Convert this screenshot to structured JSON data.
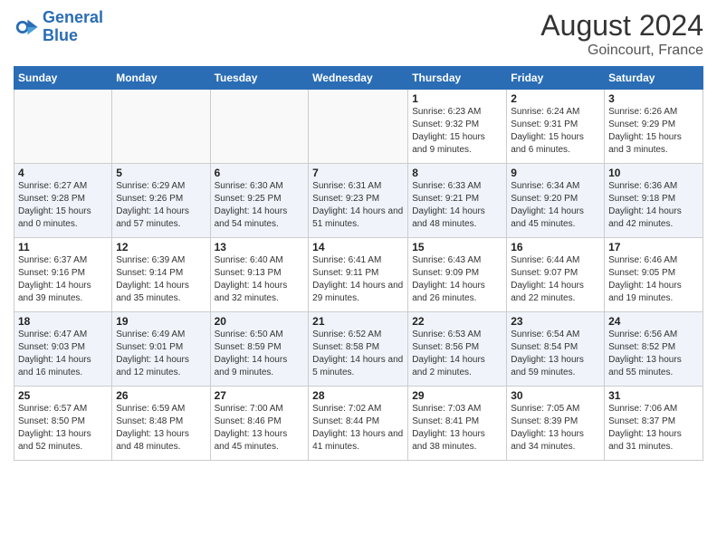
{
  "header": {
    "logo_line1": "General",
    "logo_line2": "Blue",
    "month": "August 2024",
    "location": "Goincourt, France"
  },
  "columns": [
    "Sunday",
    "Monday",
    "Tuesday",
    "Wednesday",
    "Thursday",
    "Friday",
    "Saturday"
  ],
  "weeks": [
    [
      {
        "num": "",
        "info": ""
      },
      {
        "num": "",
        "info": ""
      },
      {
        "num": "",
        "info": ""
      },
      {
        "num": "",
        "info": ""
      },
      {
        "num": "1",
        "info": "Sunrise: 6:23 AM\nSunset: 9:32 PM\nDaylight: 15 hours and 9 minutes."
      },
      {
        "num": "2",
        "info": "Sunrise: 6:24 AM\nSunset: 9:31 PM\nDaylight: 15 hours and 6 minutes."
      },
      {
        "num": "3",
        "info": "Sunrise: 6:26 AM\nSunset: 9:29 PM\nDaylight: 15 hours and 3 minutes."
      }
    ],
    [
      {
        "num": "4",
        "info": "Sunrise: 6:27 AM\nSunset: 9:28 PM\nDaylight: 15 hours and 0 minutes."
      },
      {
        "num": "5",
        "info": "Sunrise: 6:29 AM\nSunset: 9:26 PM\nDaylight: 14 hours and 57 minutes."
      },
      {
        "num": "6",
        "info": "Sunrise: 6:30 AM\nSunset: 9:25 PM\nDaylight: 14 hours and 54 minutes."
      },
      {
        "num": "7",
        "info": "Sunrise: 6:31 AM\nSunset: 9:23 PM\nDaylight: 14 hours and 51 minutes."
      },
      {
        "num": "8",
        "info": "Sunrise: 6:33 AM\nSunset: 9:21 PM\nDaylight: 14 hours and 48 minutes."
      },
      {
        "num": "9",
        "info": "Sunrise: 6:34 AM\nSunset: 9:20 PM\nDaylight: 14 hours and 45 minutes."
      },
      {
        "num": "10",
        "info": "Sunrise: 6:36 AM\nSunset: 9:18 PM\nDaylight: 14 hours and 42 minutes."
      }
    ],
    [
      {
        "num": "11",
        "info": "Sunrise: 6:37 AM\nSunset: 9:16 PM\nDaylight: 14 hours and 39 minutes."
      },
      {
        "num": "12",
        "info": "Sunrise: 6:39 AM\nSunset: 9:14 PM\nDaylight: 14 hours and 35 minutes."
      },
      {
        "num": "13",
        "info": "Sunrise: 6:40 AM\nSunset: 9:13 PM\nDaylight: 14 hours and 32 minutes."
      },
      {
        "num": "14",
        "info": "Sunrise: 6:41 AM\nSunset: 9:11 PM\nDaylight: 14 hours and 29 minutes."
      },
      {
        "num": "15",
        "info": "Sunrise: 6:43 AM\nSunset: 9:09 PM\nDaylight: 14 hours and 26 minutes."
      },
      {
        "num": "16",
        "info": "Sunrise: 6:44 AM\nSunset: 9:07 PM\nDaylight: 14 hours and 22 minutes."
      },
      {
        "num": "17",
        "info": "Sunrise: 6:46 AM\nSunset: 9:05 PM\nDaylight: 14 hours and 19 minutes."
      }
    ],
    [
      {
        "num": "18",
        "info": "Sunrise: 6:47 AM\nSunset: 9:03 PM\nDaylight: 14 hours and 16 minutes."
      },
      {
        "num": "19",
        "info": "Sunrise: 6:49 AM\nSunset: 9:01 PM\nDaylight: 14 hours and 12 minutes."
      },
      {
        "num": "20",
        "info": "Sunrise: 6:50 AM\nSunset: 8:59 PM\nDaylight: 14 hours and 9 minutes."
      },
      {
        "num": "21",
        "info": "Sunrise: 6:52 AM\nSunset: 8:58 PM\nDaylight: 14 hours and 5 minutes."
      },
      {
        "num": "22",
        "info": "Sunrise: 6:53 AM\nSunset: 8:56 PM\nDaylight: 14 hours and 2 minutes."
      },
      {
        "num": "23",
        "info": "Sunrise: 6:54 AM\nSunset: 8:54 PM\nDaylight: 13 hours and 59 minutes."
      },
      {
        "num": "24",
        "info": "Sunrise: 6:56 AM\nSunset: 8:52 PM\nDaylight: 13 hours and 55 minutes."
      }
    ],
    [
      {
        "num": "25",
        "info": "Sunrise: 6:57 AM\nSunset: 8:50 PM\nDaylight: 13 hours and 52 minutes."
      },
      {
        "num": "26",
        "info": "Sunrise: 6:59 AM\nSunset: 8:48 PM\nDaylight: 13 hours and 48 minutes."
      },
      {
        "num": "27",
        "info": "Sunrise: 7:00 AM\nSunset: 8:46 PM\nDaylight: 13 hours and 45 minutes."
      },
      {
        "num": "28",
        "info": "Sunrise: 7:02 AM\nSunset: 8:44 PM\nDaylight: 13 hours and 41 minutes."
      },
      {
        "num": "29",
        "info": "Sunrise: 7:03 AM\nSunset: 8:41 PM\nDaylight: 13 hours and 38 minutes."
      },
      {
        "num": "30",
        "info": "Sunrise: 7:05 AM\nSunset: 8:39 PM\nDaylight: 13 hours and 34 minutes."
      },
      {
        "num": "31",
        "info": "Sunrise: 7:06 AM\nSunset: 8:37 PM\nDaylight: 13 hours and 31 minutes."
      }
    ]
  ]
}
